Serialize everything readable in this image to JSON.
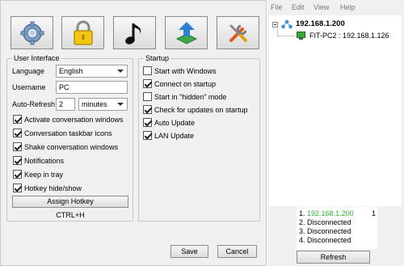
{
  "ui_interface": {
    "title": "User Interface",
    "language_label": "Language",
    "language_value": "English",
    "username_label": "Username",
    "username_value": "PC",
    "autorefresh_label": "Auto-Refresh",
    "autorefresh_value": "2",
    "autorefresh_unit": "minutes",
    "options": [
      {
        "label": "Activate conversation windows",
        "checked": true
      },
      {
        "label": "Conversation taskbar icons",
        "checked": true
      },
      {
        "label": "Shake conversation windows",
        "checked": true
      },
      {
        "label": "Notifications",
        "checked": true
      },
      {
        "label": "Keep in tray",
        "checked": true
      },
      {
        "label": "Hotkey hide/show",
        "checked": true
      }
    ],
    "assign_hotkey": "Assign Hotkey",
    "hotkey_value": "CTRL+H"
  },
  "startup": {
    "title": "Startup",
    "options": [
      {
        "label": "Start with Windows",
        "checked": false
      },
      {
        "label": "Connect on startup",
        "checked": true
      },
      {
        "label": "Start in \"hidden\" mode",
        "checked": false
      },
      {
        "label": "Check for updates on startup",
        "checked": true
      },
      {
        "label": "Auto Update",
        "checked": true
      },
      {
        "label": "LAN Update",
        "checked": true
      }
    ]
  },
  "buttons": {
    "save": "Save",
    "cancel": "Cancel"
  },
  "toolbar": {
    "icons": [
      "gear-icon",
      "padlock-icon",
      "music-note-icon",
      "update-arrow-icon",
      "tools-icon"
    ]
  },
  "network": {
    "menu": [
      "File",
      "Edit",
      "View",
      "Help"
    ],
    "tree_root": "192.168.1.200",
    "tree_child": "FIT-PC2 : 192.168.1.126",
    "list": [
      {
        "num": "1.",
        "text": "192.168.1.200",
        "color": "#2db52d"
      },
      {
        "num": "2.",
        "text": "Disconnected",
        "color": "#000000"
      },
      {
        "num": "3.",
        "text": "Disconnected",
        "color": "#000000"
      },
      {
        "num": "4.",
        "text": "Disconnected",
        "color": "#000000"
      }
    ],
    "count": "1",
    "refresh": "Refresh"
  }
}
